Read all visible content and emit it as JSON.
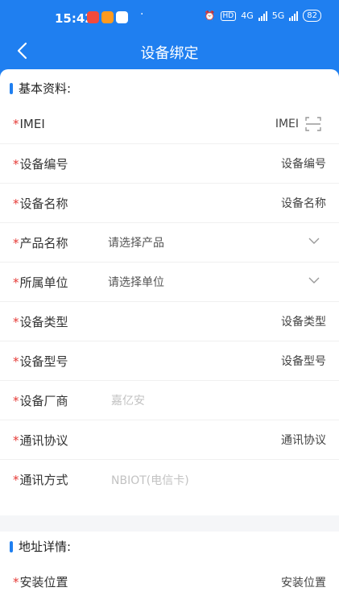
{
  "status_bar": {
    "time": "15:42",
    "network": "4G",
    "network2": "5G",
    "battery": "82",
    "hd": "HD"
  },
  "nav": {
    "title": "设备绑定"
  },
  "sections": {
    "basic": {
      "title": "基本资料:"
    },
    "address": {
      "title": "地址详情:"
    }
  },
  "required_mark": "*",
  "fields": {
    "imei": {
      "label": "IMEI",
      "placeholder": "IMEI"
    },
    "device_no": {
      "label": "设备编号",
      "placeholder": "设备编号"
    },
    "device_name": {
      "label": "设备名称",
      "placeholder": "设备名称"
    },
    "product_name": {
      "label": "产品名称",
      "placeholder": "请选择产品"
    },
    "unit": {
      "label": "所属单位",
      "placeholder": "请选择单位"
    },
    "device_type": {
      "label": "设备类型",
      "placeholder": "设备类型"
    },
    "device_model": {
      "label": "设备型号",
      "placeholder": "设备型号"
    },
    "manufacturer": {
      "label": "设备厂商",
      "value": "嘉亿安"
    },
    "protocol": {
      "label": "通讯协议",
      "placeholder": "通讯协议"
    },
    "comm_method": {
      "label": "通讯方式",
      "value": "NBIOT(电信卡)"
    },
    "install_location": {
      "label": "安装位置",
      "placeholder": "安装位置"
    }
  },
  "colors": {
    "primary": "#1f7ff0",
    "required": "#e53935",
    "disabled_text": "#c2c2c2"
  },
  "icons": {
    "back": "chevron-left-icon",
    "scan": "scan-icon",
    "dropdown": "chevron-down-icon"
  }
}
